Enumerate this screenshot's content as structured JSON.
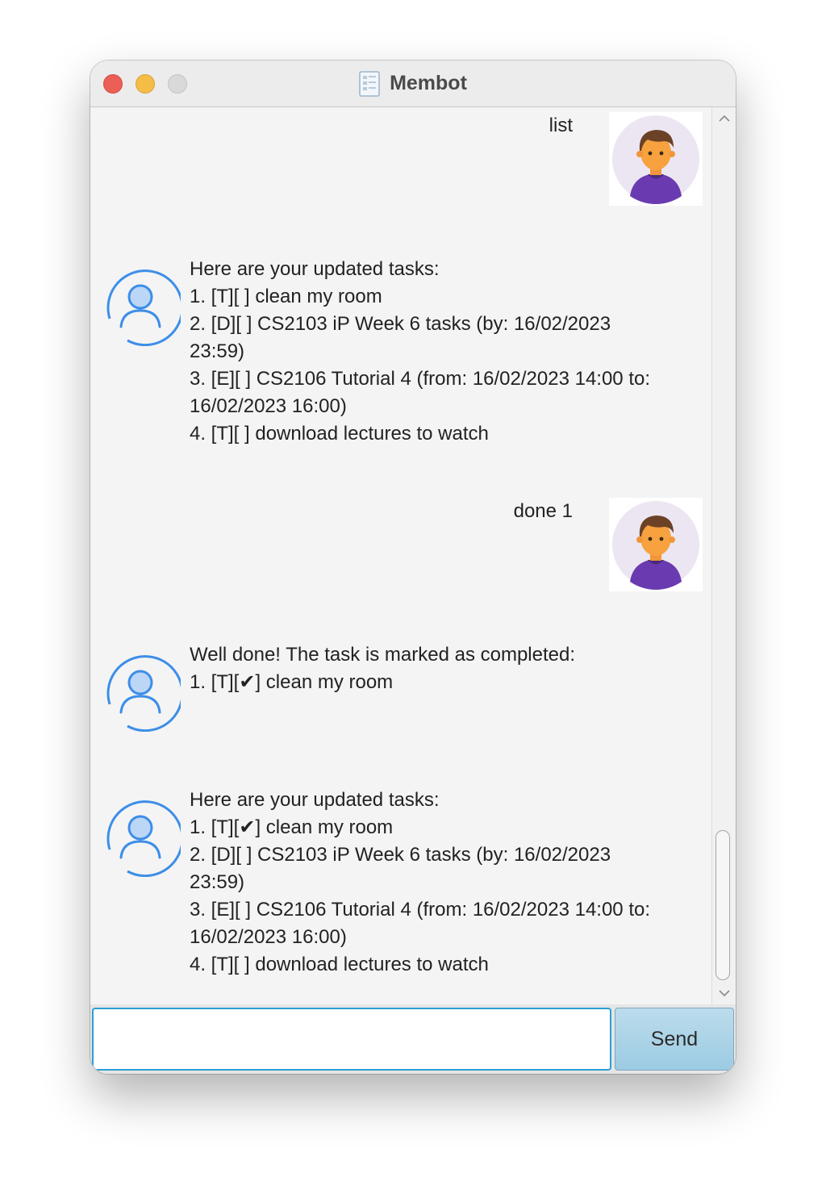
{
  "window": {
    "title": "Membot"
  },
  "conversation": {
    "user_1": "list",
    "bot_1": [
      "Here are your updated tasks:",
      "1. [T][ ] clean my room",
      "2. [D][ ] CS2103 iP Week 6 tasks (by: 16/02/2023",
      "23:59)",
      "3. [E][ ] CS2106 Tutorial 4 (from: 16/02/2023 14:00 to:",
      "16/02/2023 16:00)",
      "4. [T][ ] download lectures to watch"
    ],
    "user_2": "done 1",
    "bot_2": [
      "Well done! The task is marked as completed:",
      "1. [T][✔] clean my room"
    ],
    "bot_3": [
      "Here are your updated tasks:",
      "1. [T][✔] clean my room",
      "2. [D][ ] CS2103 iP Week 6 tasks (by: 16/02/2023",
      "23:59)",
      "3. [E][ ] CS2106 Tutorial 4 (from: 16/02/2023 14:00 to:",
      "16/02/2023 16:00)",
      "4. [T][ ] download lectures to watch"
    ]
  },
  "input": {
    "value": "",
    "send_label": "Send"
  },
  "icons": {
    "app": "document-icon",
    "bot_avatar": "user-outline-icon",
    "user_avatar": "person-avatar-icon",
    "scroll_up": "chevron-up-icon",
    "scroll_down": "chevron-down-icon"
  },
  "colors": {
    "bot_avatar_stroke": "#3d8ee8",
    "send_button": "#a9d3e8",
    "input_focus": "#2a9fd6",
    "close": "#ec5f57",
    "minimize": "#f3bd48"
  }
}
